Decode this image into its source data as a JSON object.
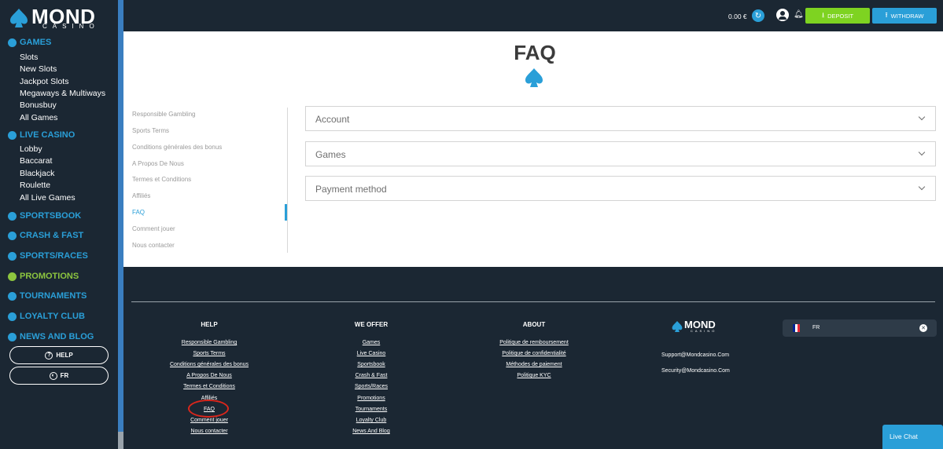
{
  "brand": {
    "name": "MOND",
    "sub": "CASINO"
  },
  "sidebar": {
    "games_label": "GAMES",
    "games_items": [
      "Slots",
      "New Slots",
      "Jackpot Slots",
      "Megaways & Multiways",
      "Bonusbuy",
      "All Games"
    ],
    "live_label": "LIVE CASINO",
    "live_items": [
      "Lobby",
      "Baccarat",
      "Blackjack",
      "Roulette",
      "All Live Games"
    ],
    "sections": [
      "SPORTSBOOK",
      "CRASH & FAST",
      "SPORTS/RACES",
      "PROMOTIONS",
      "TOURNAMENTS",
      "LOYALTY CLUB",
      "NEWS AND BLOG"
    ],
    "help_button": "HELP",
    "lang_button": "FR"
  },
  "topbar": {
    "balance": "0.00 €",
    "deposit_label": "DEPOSIT",
    "withdraw_label": "WITHDRAW"
  },
  "main": {
    "title": "FAQ",
    "nav": [
      "Responsible Gambling",
      "Sports Terms",
      "Conditions générales des bonus",
      "A Propos De Nous",
      "Termes et Conditions",
      "Affiliés",
      "FAQ",
      "Comment jouer",
      "Nous contacter"
    ],
    "active_nav": "FAQ",
    "accordions": [
      "Account",
      "Games",
      "Payment method"
    ]
  },
  "footer": {
    "help_head": "HELP",
    "help_links": [
      "Responsible Gambling",
      "Sports Terms",
      "Conditions générales des bonus",
      "A Propos De Nous",
      "Termes et Conditions",
      "Affiliés",
      "FAQ",
      "Comment jouer",
      "Nous contacter"
    ],
    "offer_head": "WE OFFER",
    "offer_links": [
      "Games",
      "Live Casino",
      "Sportsbook",
      "Crash & Fast",
      "Sports/Races",
      "Promotions",
      "Tournaments",
      "Loyalty Club",
      "News And Blog"
    ],
    "about_head": "ABOUT",
    "about_links": [
      "Politique de remboursement",
      "Politique de confidentialité",
      "Méthodes de paiement",
      "Politique KYC"
    ],
    "support_email": "Support@Mondcasino.Com",
    "security_email": "Security@Mondcasino.Com",
    "lang": "FR"
  },
  "live_chat": "Live Chat",
  "colors": {
    "accent": "#2a9fd8",
    "green": "#7ed321",
    "dark": "#1b2733",
    "highlight": "#d9261c"
  }
}
